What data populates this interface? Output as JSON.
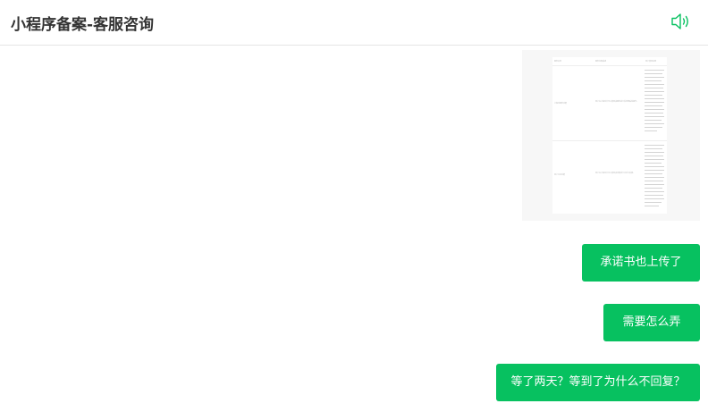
{
  "header": {
    "title": "小程序备案-客服咨询",
    "speaker_icon": "speaker-icon"
  },
  "colors": {
    "bubble_bg": "#07c160",
    "bubble_text": "#ffffff",
    "icon_accent": "#07c160",
    "title_text": "#333333"
  },
  "messages": {
    "image": {
      "thumb_header": [
        "服务名称",
        "服务内容描述",
        "用户使用说明"
      ],
      "thumb_rows": [
        {
          "name": "小程序服务功能",
          "desc": "用户在小程序中可以使用该服务进行信息查看等操作。"
        },
        {
          "name": "用户互动功能",
          "desc": "用户在小程序中可以使用该功能进行评论与反馈。"
        }
      ]
    },
    "texts": [
      {
        "text": "承诺书也上传了"
      },
      {
        "text": "需要怎么弄"
      },
      {
        "text": "等了两天？等到了为什么不回复？"
      }
    ]
  }
}
